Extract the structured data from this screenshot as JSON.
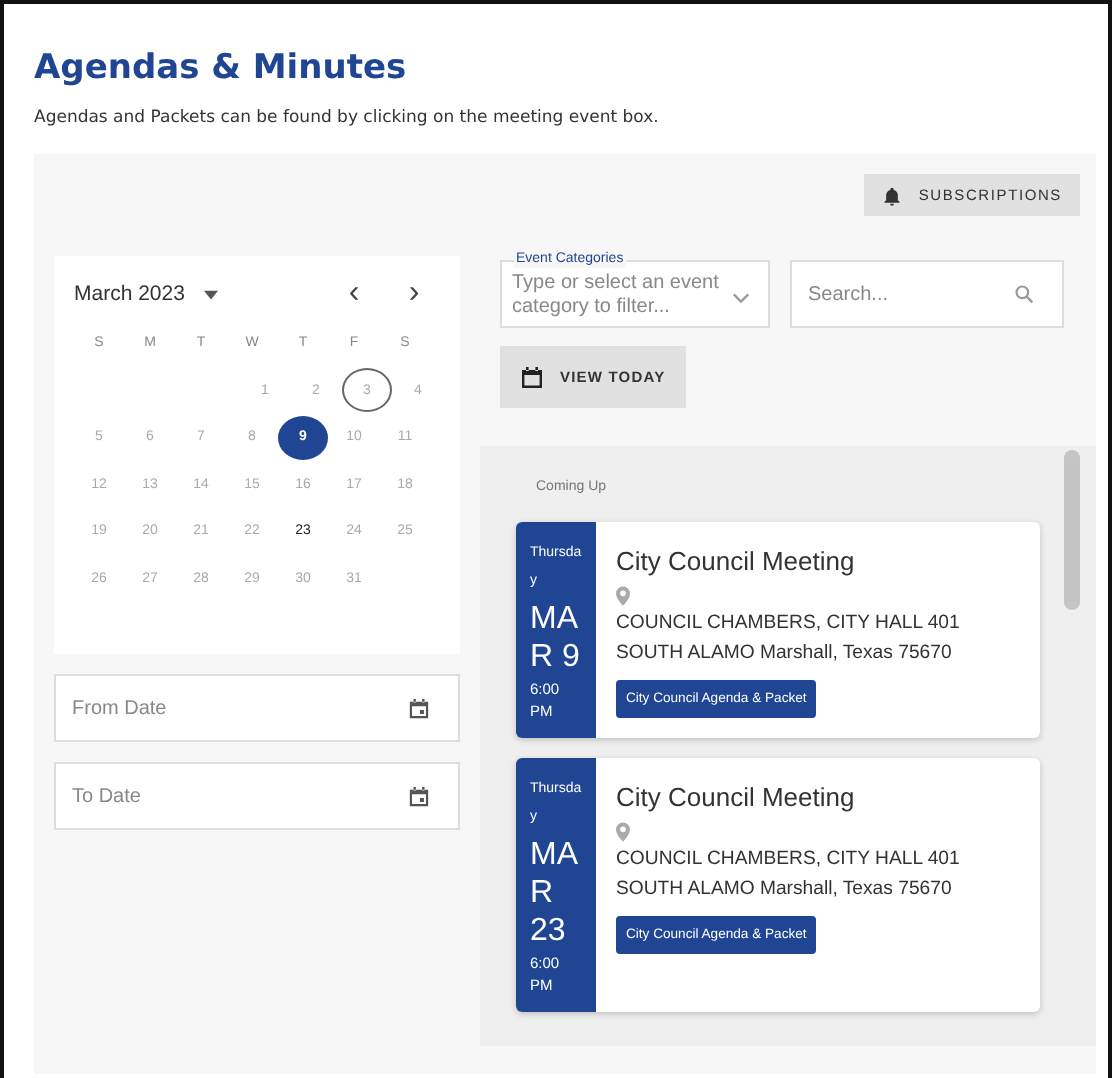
{
  "header": {
    "title": "Agendas & Minutes",
    "description": "Agendas and Packets can be found by clicking on the meeting event box."
  },
  "subscriptions_button": "SUBSCRIPTIONS",
  "calendar": {
    "month": "March 2023",
    "prev": "‹",
    "next": "›",
    "weekdays": [
      "S",
      "M",
      "T",
      "W",
      "T",
      "F",
      "S"
    ],
    "weeks": [
      {
        "days": [
          {
            "label": "1",
            "selected": false,
            "outlined": false,
            "has_event": false
          },
          {
            "label": "2",
            "selected": false,
            "outlined": false,
            "has_event": false
          },
          {
            "label": "3",
            "selected": false,
            "outlined": true,
            "has_event": false
          },
          {
            "label": "4",
            "selected": false,
            "outlined": false,
            "has_event": false
          }
        ]
      },
      {
        "days": [
          {
            "label": "5",
            "selected": false,
            "outlined": false,
            "has_event": false
          },
          {
            "label": "6",
            "selected": false,
            "outlined": false,
            "has_event": false
          },
          {
            "label": "7",
            "selected": false,
            "outlined": false,
            "has_event": false
          },
          {
            "label": "8",
            "selected": false,
            "outlined": false,
            "has_event": false
          },
          {
            "label": "9",
            "selected": true,
            "outlined": false,
            "has_event": true
          },
          {
            "label": "10",
            "selected": false,
            "outlined": false,
            "has_event": false
          },
          {
            "label": "11",
            "selected": false,
            "outlined": false,
            "has_event": false
          }
        ]
      },
      {
        "days": [
          {
            "label": "12",
            "selected": false,
            "outlined": false,
            "has_event": false
          },
          {
            "label": "13",
            "selected": false,
            "outlined": false,
            "has_event": false
          },
          {
            "label": "14",
            "selected": false,
            "outlined": false,
            "has_event": false
          },
          {
            "label": "15",
            "selected": false,
            "outlined": false,
            "has_event": false
          },
          {
            "label": "16",
            "selected": false,
            "outlined": false,
            "has_event": false
          },
          {
            "label": "17",
            "selected": false,
            "outlined": false,
            "has_event": false
          },
          {
            "label": "18",
            "selected": false,
            "outlined": false,
            "has_event": false
          }
        ]
      },
      {
        "days": [
          {
            "label": "19",
            "selected": false,
            "outlined": false,
            "has_event": false
          },
          {
            "label": "20",
            "selected": false,
            "outlined": false,
            "has_event": false
          },
          {
            "label": "21",
            "selected": false,
            "outlined": false,
            "has_event": false
          },
          {
            "label": "22",
            "selected": false,
            "outlined": false,
            "has_event": false
          },
          {
            "label": "23",
            "selected": false,
            "outlined": false,
            "has_event": true
          },
          {
            "label": "24",
            "selected": false,
            "outlined": false,
            "has_event": false
          },
          {
            "label": "25",
            "selected": false,
            "outlined": false,
            "has_event": false
          }
        ]
      },
      {
        "days": [
          {
            "label": "26",
            "selected": false,
            "outlined": false,
            "has_event": false
          },
          {
            "label": "27",
            "selected": false,
            "outlined": false,
            "has_event": false
          },
          {
            "label": "28",
            "selected": false,
            "outlined": false,
            "has_event": false
          },
          {
            "label": "29",
            "selected": false,
            "outlined": false,
            "has_event": false
          },
          {
            "label": "30",
            "selected": false,
            "outlined": false,
            "has_event": false
          },
          {
            "label": "31",
            "selected": false,
            "outlined": false,
            "has_event": false
          }
        ]
      }
    ]
  },
  "from_date": {
    "placeholder": "From Date"
  },
  "to_date": {
    "placeholder": "To Date"
  },
  "event_categories": {
    "label": "Event Categories",
    "placeholder": "Type or select an event category to filter..."
  },
  "search": {
    "placeholder": "Search..."
  },
  "view_today_button": "VIEW TODAY",
  "events": {
    "heading": "Coming Up",
    "items": [
      {
        "weekday": "Thursday",
        "date": "MAR 9",
        "time": "6:00 PM",
        "title": "City Council Meeting",
        "location": "COUNCIL CHAMBERS, CITY HALL 401 SOUTH ALAMO Marshall, Texas 75670",
        "link": "City Council Agenda & Packet"
      },
      {
        "weekday": "Thursday",
        "date": "MAR 23",
        "time": "6:00 PM",
        "title": "City Council Meeting",
        "location": "COUNCIL CHAMBERS, CITY HALL 401 SOUTH ALAMO Marshall, Texas 75670",
        "link": "City Council Agenda & Packet"
      }
    ]
  }
}
